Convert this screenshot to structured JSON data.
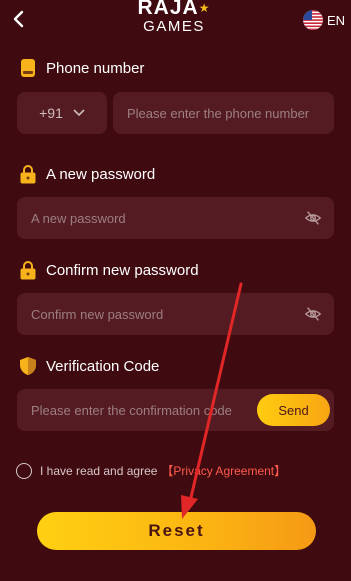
{
  "header": {
    "logo_top": "RAJA",
    "logo_bottom": "GAMES",
    "language": "EN"
  },
  "phone": {
    "label": "Phone number",
    "country_code": "+91",
    "placeholder": "Please enter the phone number"
  },
  "new_password": {
    "label": "A new password",
    "placeholder": "A new password"
  },
  "confirm_password": {
    "label": "Confirm new password",
    "placeholder": "Confirm new password"
  },
  "verification": {
    "label": "Verification Code",
    "placeholder": "Please enter the confirmation code",
    "send_label": "Send"
  },
  "agreement": {
    "text": "I have read and agree",
    "link": "【Privacy Agreement】"
  },
  "reset_label": "Reset",
  "colors": {
    "background": "#3f0b10",
    "field": "#551b22",
    "accent": "#fbb412",
    "link": "#ff5a4a",
    "annotation_arrow": "#e02626"
  }
}
